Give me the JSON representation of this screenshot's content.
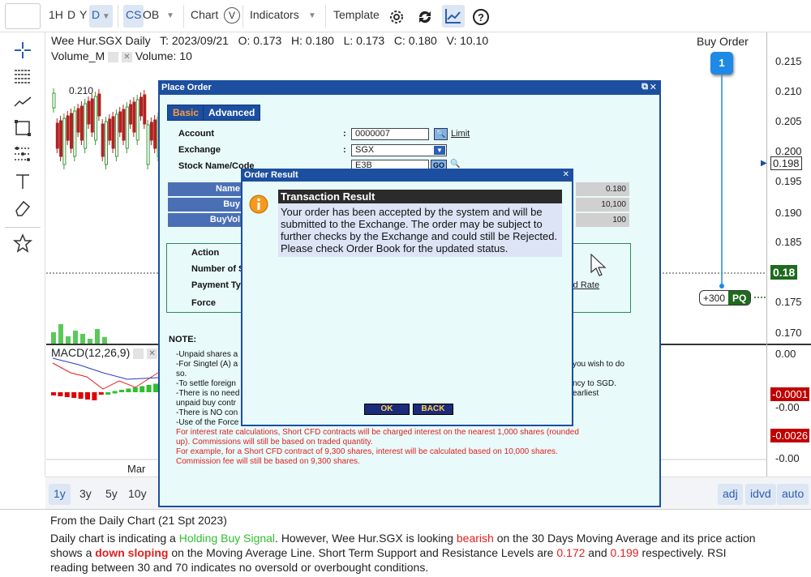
{
  "toolbar": {
    "periods": [
      "1H",
      "D",
      "Y"
    ],
    "period_selected": "D",
    "cs": "CS",
    "ob": "OB",
    "chart": "Chart",
    "chart_badge": "V",
    "indicators": "Indicators",
    "template": "Template"
  },
  "chart": {
    "header": {
      "symbol": "Wee Hur.SGX Daily",
      "t": "T: 2023/09/21",
      "o": "O: 0.173",
      "h": "H: 0.180",
      "l": "L: 0.173",
      "c": "C: 0.180",
      "v": "V: 10.10"
    },
    "volume_label": "Volume_M",
    "volume_value": "Volume: 10",
    "price_annotation": "0.210",
    "month_label": "Mar",
    "macd_label": "MACD(12,26,9)",
    "buy_order_label": "Buy Order",
    "buy_order_marker": "1",
    "order_tag_qty": "+300",
    "order_tag_type": "PQ"
  },
  "price_axis": {
    "ticks": [
      "0.215",
      "0.210",
      "0.205",
      "0.200",
      "0.195",
      "0.190",
      "0.185",
      "0.175",
      "0.170"
    ],
    "highlight_198": "0.198",
    "highlight_last": "0.18",
    "macd_ticks": [
      "0.00",
      "-0.00",
      "-0.00"
    ],
    "macd_red1": "-0.0001",
    "macd_red2": "-0.0026"
  },
  "bottom_bar": {
    "ranges": [
      "1y",
      "3y",
      "5y",
      "10y"
    ],
    "selected": "1y",
    "right_buttons": [
      "adj",
      "idvd",
      "auto"
    ]
  },
  "commentary": {
    "title": "From the Daily Chart (21 Spt 2023)",
    "p1": "Daily chart is indicating a ",
    "signal": "Holding Buy Signal",
    "p2": ". However, Wee Hur.SGX is looking ",
    "bearish": "bearish",
    "p3": " on the 30 Days Moving Average and its price action shows a ",
    "down": "down sloping",
    "p4": " on the Moving Average Line. Short Term Support and Resistance Levels are ",
    "support": "0.172",
    "p5": " and ",
    "resistance": "0.199",
    "p6": " respectively. RSI reading between 30 and 70 indicates no oversold or overbought conditions."
  },
  "place_order": {
    "title": "Place Order",
    "tab_basic": "Basic",
    "tab_advanced": "Advanced",
    "account_label": "Account",
    "account_value": "0000007",
    "limit_link": "Limit",
    "exchange_label": "Exchange",
    "exchange_value": "SGX",
    "stock_label": "Stock Name/Code",
    "stock_value": "E3B",
    "go_label": "GO",
    "name_hdr": "Name",
    "buy_hdr": "Buy",
    "buyvol_hdr": "BuyVol",
    "val1": "0.180",
    "val2": "10,100",
    "val3": "100",
    "action_label": "Action",
    "number_label": "Number of S",
    "payment_label": "Payment Typ",
    "force_label": "Force",
    "rate_link": "rd Rate",
    "note_title": "NOTE:",
    "notes": [
      "-Unpaid shares a",
      "-For Singtel (A) a",
      "so.",
      "-To settle foreign",
      "-There is no need",
      "unpaid buy contr",
      "-There is NO con",
      "-Use of the Force"
    ],
    "notes_right": [
      "you wish to do",
      "ncy to SGD.",
      "earliest"
    ],
    "red_notes": [
      "For interest rate calculations, Short CFD contracts will be charged interest on the nearest 1,000 shares (rounded",
      "up). Commissions will still be based on traded quantity.",
      "For example, for a Short CFD contract of 9,300 shares, interest will be calculated based on 10,000 shares.",
      "Commission fee will still be based on 9,300 shares."
    ]
  },
  "order_result": {
    "title": "Order Result",
    "heading": "Transaction Result",
    "message": "Your order has been accepted by the system and will be submitted to the Exchange. The order may be subject to further checks by the Exchange and could still be Rejected. Please check Order Book for the updated status.",
    "ok": "OK",
    "back": "BACK"
  },
  "colors": {
    "dialog_blue": "#1c4fa0",
    "up": "#3a9a3a",
    "down": "#b22222",
    "macd_neg": "#e00000",
    "macd_pos": "#2fbf2f"
  }
}
